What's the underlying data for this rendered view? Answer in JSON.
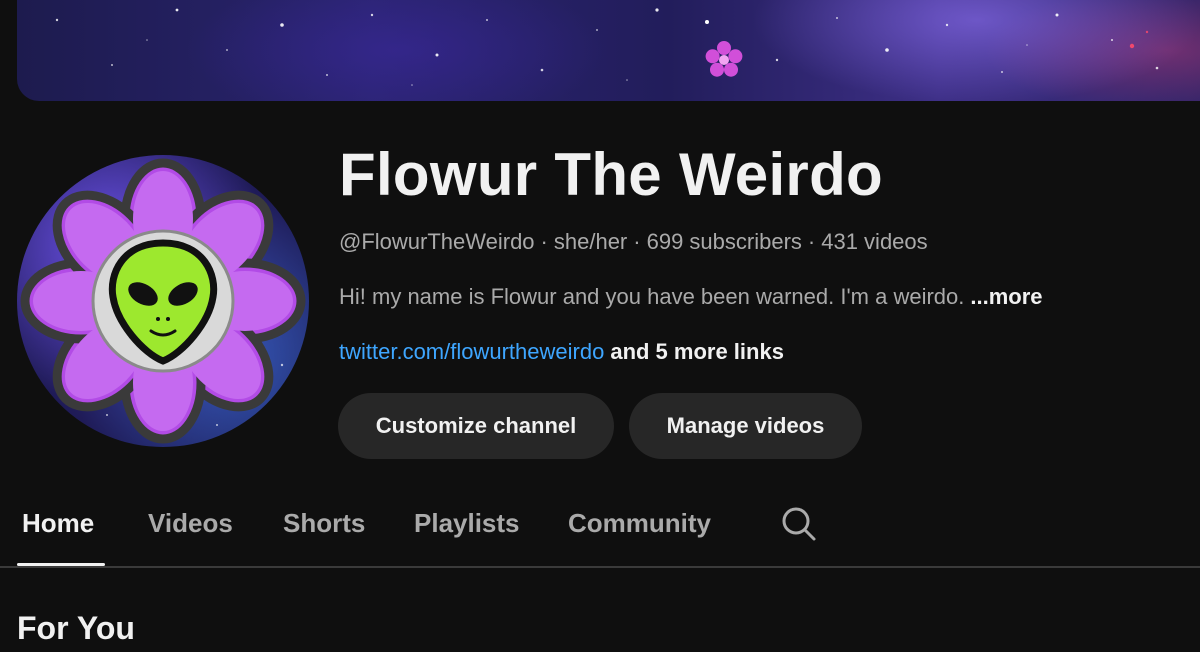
{
  "channel": {
    "name": "Flowur The Weirdo",
    "handle": "@FlowurTheWeirdo",
    "pronouns": "she/her",
    "subscribers": "699 subscribers",
    "videos": "431 videos",
    "separator": "·",
    "description": "Hi! my name is Flowur and you have been warned. I'm a weirdo.",
    "description_more": "...more",
    "link": "twitter.com/flowurtheweirdo",
    "more_links": "and 5 more links"
  },
  "actions": {
    "customize_label": "Customize channel",
    "manage_label": "Manage videos"
  },
  "tabs": [
    {
      "label": "Home",
      "active": true
    },
    {
      "label": "Videos",
      "active": false
    },
    {
      "label": "Shorts",
      "active": false
    },
    {
      "label": "Playlists",
      "active": false
    },
    {
      "label": "Community",
      "active": false
    }
  ],
  "section": {
    "title": "For You"
  },
  "icons": {
    "tab_search": "search-icon",
    "banner_flower": "flower-icon",
    "avatar": "alien-flower-avatar"
  },
  "colors": {
    "background": "#0f0f0f",
    "text_primary": "#f1f1f1",
    "text_secondary": "#aaaaaa",
    "link": "#3ea6ff",
    "button_bg": "#272727",
    "flower_purple": "#b24be6",
    "alien_green": "#9de82e"
  }
}
